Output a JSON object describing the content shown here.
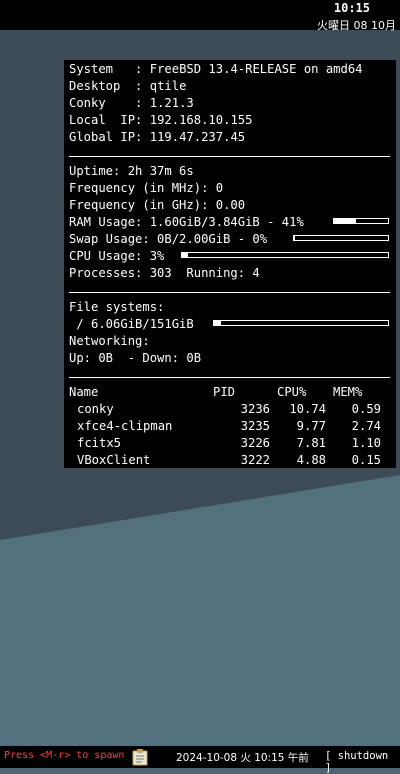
{
  "top_bar": {
    "time": "10:15",
    "date": "火曜日 08 10月"
  },
  "conky": {
    "info": [
      {
        "label": "System   ",
        "value": "FreeBSD 13.4-RELEASE on amd64"
      },
      {
        "label": "Desktop  ",
        "value": "qtile"
      },
      {
        "label": "Conky    ",
        "value": "1.21.3"
      },
      {
        "label": "Local  IP",
        "value": "192.168.10.155"
      },
      {
        "label": "Global IP",
        "value": "119.47.237.45"
      }
    ],
    "uptime": "Uptime: 2h 37m 6s",
    "freq_mhz": "Frequency (in MHz): 0",
    "freq_ghz": "Frequency (in GHz): 0.00",
    "ram": {
      "text": "RAM Usage: 1.60GiB/3.84GiB - 41%",
      "fraction": 0.41
    },
    "swap": {
      "text": "Swap Usage: 0B/2.00GiB - 0%",
      "fraction": 0.0
    },
    "cpu": {
      "text": "CPU Usage: 3%",
      "fraction": 0.03
    },
    "processes": "Processes: 303  Running: 4",
    "fs_title": "File systems:",
    "fs_root": {
      "text": " / 6.06GiB/151GiB",
      "fraction": 0.04
    },
    "net_title": "Networking:",
    "net_line": "Up: 0B  - Down: 0B",
    "proc_headers": {
      "name": "Name",
      "pid": "PID",
      "cpu": "CPU%",
      "mem": "MEM%"
    },
    "procs": [
      {
        "name": "conky",
        "pid": "3236",
        "cpu": "10.74",
        "mem": "0.59"
      },
      {
        "name": "xfce4-clipman",
        "pid": "3235",
        "cpu": "9.77",
        "mem": "2.74"
      },
      {
        "name": "fcitx5",
        "pid": "3226",
        "cpu": "7.81",
        "mem": "1.10"
      },
      {
        "name": "VBoxClient",
        "pid": "3222",
        "cpu": "4.88",
        "mem": "0.15"
      }
    ]
  },
  "bottom_bar": {
    "prompt": "Press <M-r> to spawn",
    "clip_icon": "clipboard-icon",
    "date": "2024-10-08 火 10:15 午前",
    "shutdown": "[ shutdown ]"
  },
  "colors": {
    "desktop": "#4d6573",
    "desktop_dark": "#3d4e59",
    "panel": "#000000",
    "prompt": "#ff4040"
  }
}
